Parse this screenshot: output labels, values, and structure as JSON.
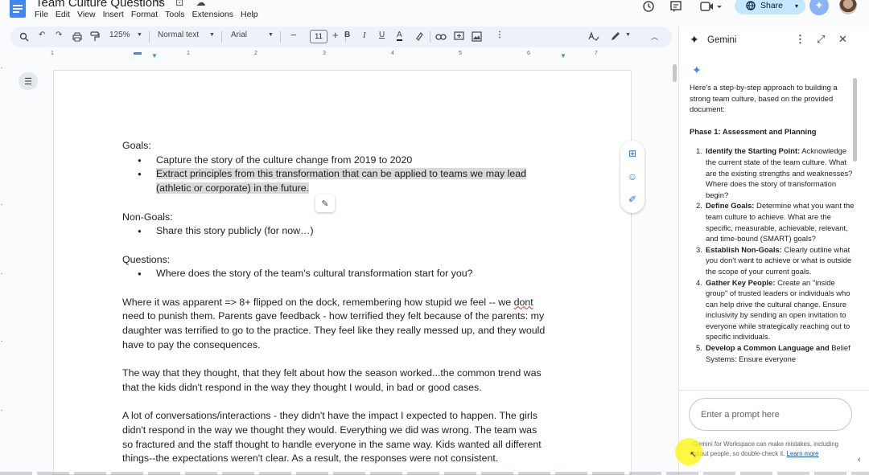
{
  "doc": {
    "title": "Team Culture Questions",
    "title_icons": "☆ ⊡ ☁",
    "menu": [
      "File",
      "Edit",
      "View",
      "Insert",
      "Format",
      "Tools",
      "Extensions",
      "Help"
    ]
  },
  "header_right": {
    "share_label": "Share",
    "share_icon": "globe-icon",
    "gemini_icon": "sparkle-icon"
  },
  "toolbar": {
    "zoom": "125%",
    "style": "Normal text",
    "font": "Arial",
    "font_size": "11",
    "minus": "−",
    "plus": "+",
    "bold": "B",
    "italic": "I",
    "underline": "U",
    "text_color": "A",
    "more": "⋮"
  },
  "ruler": {
    "numbers": [
      "1",
      "1",
      "2",
      "3",
      "4",
      "5",
      "6",
      "7"
    ]
  },
  "document": {
    "goals_heading": "Goals:",
    "goals": [
      "Capture the story of the culture change from 2019 to 2020",
      "Extract principles from this transformation that can be applied to teams we may lead",
      "(athletic or corporate) in the future."
    ],
    "nongoals_heading": "Non-Goals:",
    "nongoals": [
      "Share this story publicly (for now…)"
    ],
    "questions_heading": "Questions:",
    "questions": [
      "Where does the story of the team's cultural transformation start for you?"
    ],
    "para1": [
      "Where it was apparent => 8+ flipped on the dock, remembering how stupid we feel -- we ",
      "dont",
      "need to punish them. Parents gave feedback - how terrified they felt because of the parents: my",
      "daughter was terrified to go to the practice. They feel like they really messed up, and they would",
      "have to pay the consequences."
    ],
    "para2": [
      "The way that they thought, that they felt about how the season worked...the common trend was",
      "that the kids didn't respond in the way they thought I would, in bad or good cases."
    ],
    "para3": [
      "A lot of conversations/interactions - they didn't have the impact I expected to happen. The girls",
      "didn't respond in the way we thought they would. Everything we did was wrong. The team was",
      "so fractured and the staff thought to handle everyone in the same way. Kids wanted all different",
      "things--the expectations weren't clear. As a result, the responses were not consistent."
    ]
  },
  "gemini": {
    "title": "Gemini",
    "intro": "Here's a step-by-step approach to building a strong team culture, based on the provided document:",
    "phase": "Phase 1: Assessment and Planning",
    "steps": [
      {
        "num": "1.",
        "title": "Identify the Starting Point:",
        "text": " Acknowledge the current state of the team culture. What are the existing strengths and weaknesses? Where does the story of transformation begin?"
      },
      {
        "num": "2.",
        "title": "Define Goals:",
        "text": " Determine what you want the team culture to achieve. What are the specific, measurable, achievable, relevant, and time-bound (SMART) goals?"
      },
      {
        "num": "3.",
        "title": "Establish Non-Goals:",
        "text": " Clearly outline what you don't want to achieve or what is outside the scope of your current goals."
      },
      {
        "num": "4.",
        "title": "Gather Key People:",
        "text": " Create an \"inside group\" of trusted leaders or individuals who can help drive the cultural change. Ensure inclusivity by sending an open invitation to everyone while strategically reaching out to specific individuals."
      },
      {
        "num": "5.",
        "title": "Develop a Common Language and",
        "text": " Belief Systems: Ensure everyone"
      }
    ],
    "prompt_placeholder": "Enter a prompt here",
    "disclaimer": "Gemini for Workspace can make mistakes, including about people, so double-check it. ",
    "learn_more": "Learn more"
  }
}
